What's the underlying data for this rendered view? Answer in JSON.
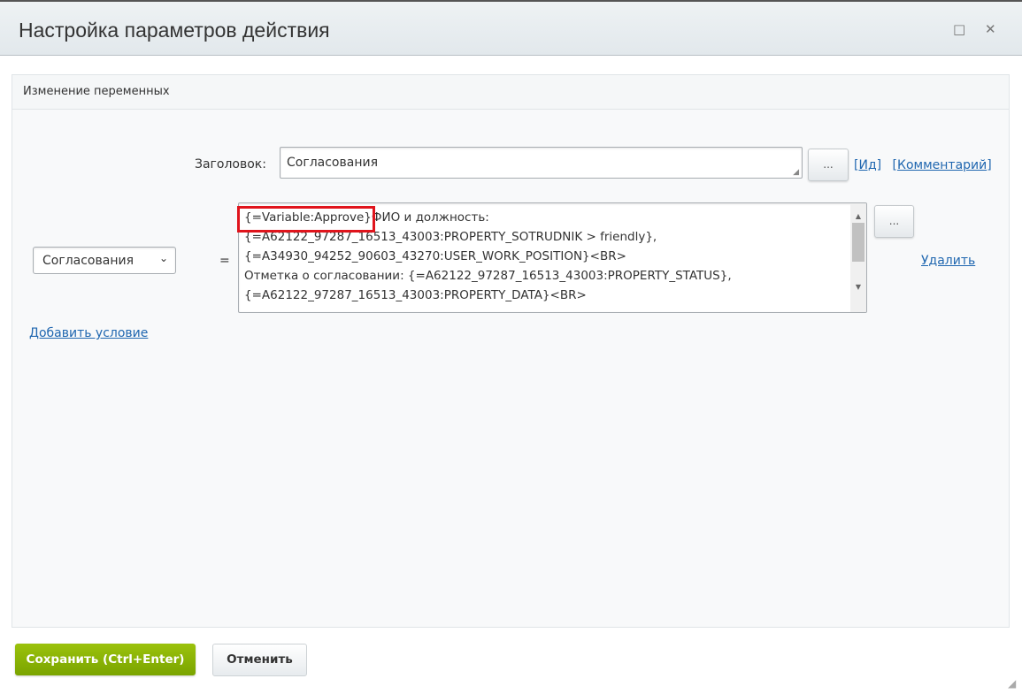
{
  "window": {
    "title": "Настройка параметров действия",
    "maximize_icon": "□",
    "close_icon": "✕"
  },
  "panel": {
    "header": "Изменение переменных"
  },
  "form": {
    "heading_label": "Заголовок:",
    "heading_value": "Согласования",
    "dots": "...",
    "id_link": "Ид",
    "comment_link": "Комментарий",
    "bracket_open": "[",
    "bracket_close": "]",
    "variable_select": "Согласования",
    "equals": "=",
    "value_lines": [
      "{=Variable:Approve}ФИО и должность:",
      "{=A62122_97287_16513_43003:PROPERTY_SOTRUDNIK > friendly},",
      "{=A34930_94252_90603_43270:USER_WORK_POSITION}<BR>",
      "Отметка о согласовании: {=A62122_97287_16513_43003:PROPERTY_STATUS},",
      "{=A62122_97287_16513_43003:PROPERTY_DATA}<BR>"
    ],
    "delete_link": "Удалить",
    "add_condition_link": "Добавить условие"
  },
  "footer": {
    "save": "Сохранить (Ctrl+Enter)",
    "cancel": "Отменить"
  },
  "colors": {
    "save": "#8cb50a",
    "highlight": "#e0141c",
    "link": "#2067b0"
  }
}
